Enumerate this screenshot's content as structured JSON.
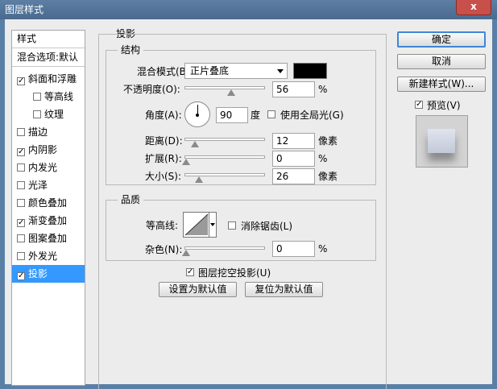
{
  "window": {
    "title": "图层样式",
    "close": "x"
  },
  "left_list": {
    "header_styles": "样式",
    "header_blend": "混合选项:默认",
    "items": [
      {
        "label": "斜面和浮雕",
        "checked": true
      },
      {
        "label": "等高线",
        "checked": false
      },
      {
        "label": "纹理",
        "checked": false
      },
      {
        "label": "描边",
        "checked": false
      },
      {
        "label": "内阴影",
        "checked": true
      },
      {
        "label": "内发光",
        "checked": false
      },
      {
        "label": "光泽",
        "checked": false
      },
      {
        "label": "颜色叠加",
        "checked": false
      },
      {
        "label": "渐变叠加",
        "checked": true
      },
      {
        "label": "图案叠加",
        "checked": false
      },
      {
        "label": "外发光",
        "checked": false
      },
      {
        "label": "投影",
        "checked": true,
        "selected": true
      }
    ]
  },
  "panel": {
    "title": "投影",
    "structure": {
      "title": "结构",
      "blend_mode_label": "混合模式(B):",
      "blend_mode_value": "正片叠底",
      "swatch_color": "#000000",
      "opacity_label": "不透明度(O):",
      "opacity_value": "56",
      "opacity_unit": "%",
      "opacity_level": 0.56,
      "angle_label": "角度(A):",
      "angle_value": "90",
      "angle_unit": "度",
      "global_light_label": "使用全局光(G)",
      "global_light_checked": false,
      "distance_label": "距离(D):",
      "distance_value": "12",
      "distance_unit": "像素",
      "spread_label": "扩展(R):",
      "spread_value": "0",
      "spread_unit": "%",
      "size_label": "大小(S):",
      "size_value": "26",
      "size_unit": "像素"
    },
    "quality": {
      "title": "品质",
      "contour_label": "等高线:",
      "antialias_label": "消除锯齿(L)",
      "antialias_checked": false,
      "noise_label": "杂色(N):",
      "noise_value": "0",
      "noise_unit": "%"
    },
    "knockout_label": "图层挖空投影(U)",
    "knockout_checked": true,
    "set_default_label": "设置为默认值",
    "reset_default_label": "复位为默认值"
  },
  "buttons": {
    "ok": "确定",
    "cancel": "取消",
    "new_style": "新建样式(W)...",
    "preview_label": "预览(V)",
    "preview_checked": true
  },
  "colors": {
    "titlebar": "#4f719a",
    "selection": "#3399ff",
    "default_button_border": "#3f86d9"
  }
}
